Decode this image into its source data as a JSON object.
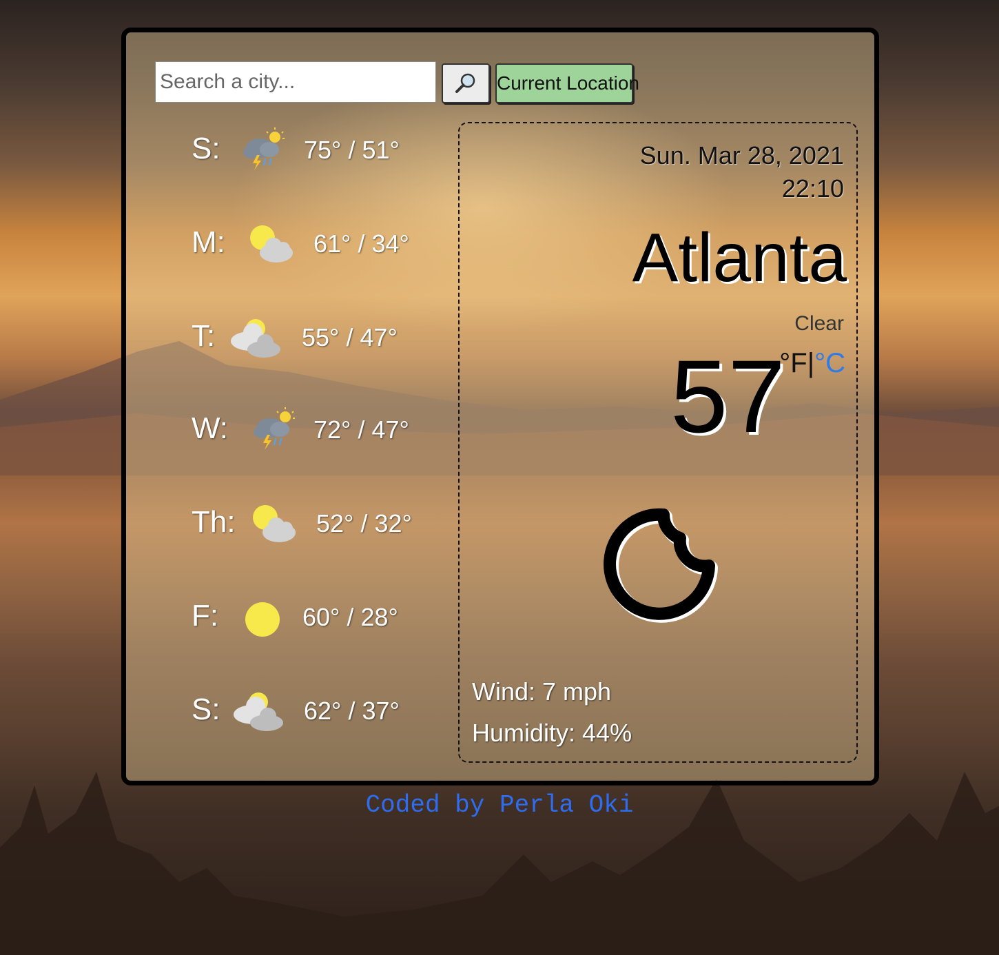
{
  "search": {
    "placeholder": "Search a city...",
    "value": "",
    "icon": "magnifier-icon",
    "current_location_label": "Current Location"
  },
  "forecast": [
    {
      "day": "S:",
      "icon": "thunderstorm-sun-icon",
      "temps": "75° / 51°"
    },
    {
      "day": "M:",
      "icon": "partly-cloudy-icon",
      "temps": "61° / 34°"
    },
    {
      "day": "T:",
      "icon": "cloudy-icon",
      "temps": "55° / 47°"
    },
    {
      "day": "W:",
      "icon": "thunderstorm-sun-icon",
      "temps": "72° / 47°"
    },
    {
      "day": "Th:",
      "icon": "partly-cloudy-icon",
      "temps": "52° / 32°"
    },
    {
      "day": "F:",
      "icon": "sun-icon",
      "temps": "60° / 28°"
    },
    {
      "day": "S:",
      "icon": "cloudy-icon",
      "temps": "62° / 37°"
    }
  ],
  "current": {
    "date": "Sun. Mar 28, 2021",
    "time": "22:10",
    "city": "Atlanta",
    "description": "Clear",
    "temperature": "57",
    "unit_f": "°F",
    "unit_sep": "|",
    "unit_c": "°C",
    "icon": "moon-icon",
    "wind": "Wind: 7 mph",
    "humidity": "Humidity: 44%"
  },
  "footer": {
    "credit": "Coded by Perla Oki"
  },
  "colors": {
    "card_border": "#000000",
    "location_button": "#9ed39a",
    "unit_active_link": "#2e7bea",
    "credit_link": "#2e6cf0",
    "sun": "#f7e84b",
    "cloud": "#d2d2d2"
  }
}
